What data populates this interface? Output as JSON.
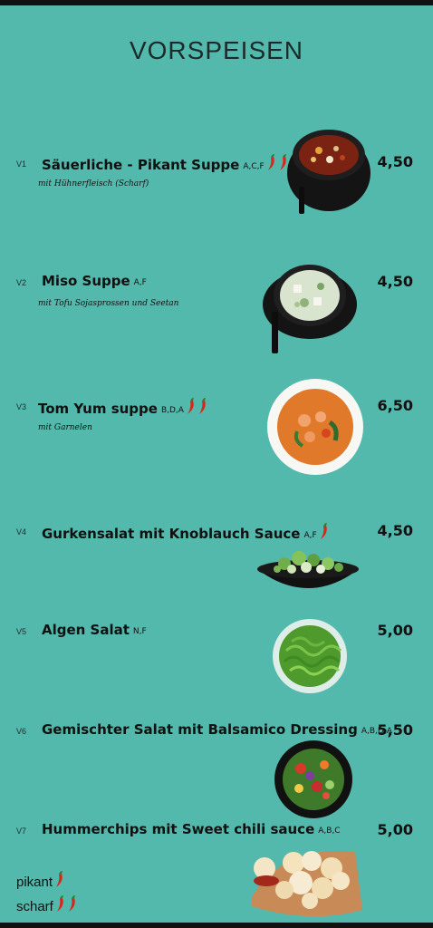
{
  "title": "VORSPEISEN",
  "items": [
    {
      "code": "V1",
      "name": "Säuerliche - Pikant Suppe",
      "allergens": "A,C,F",
      "chilis": 2,
      "desc": "mit Hühnerfleisch (Scharf)",
      "price": "4,50"
    },
    {
      "code": "V2",
      "name": "Miso Suppe",
      "allergens": "A,F",
      "chilis": 0,
      "desc": "mit Tofu Sojasprossen und Seetan",
      "price": "4,50"
    },
    {
      "code": "V3",
      "name": "Tom Yum suppe",
      "allergens": "B,D,A",
      "chilis": 2,
      "desc": "mit Garnelen",
      "price": "6,50"
    },
    {
      "code": "V4",
      "name": "Gurkensalat mit Knoblauch Sauce",
      "allergens": "A,F",
      "chilis": 1,
      "desc": "",
      "price": "4,50"
    },
    {
      "code": "V5",
      "name": "Algen Salat",
      "allergens": "N,F",
      "chilis": 0,
      "desc": "",
      "price": "5,00"
    },
    {
      "code": "V6",
      "name": "Gemischter Salat mit Balsamico Dressing",
      "allergens": "A,B,D,A",
      "chilis": 0,
      "desc": "",
      "price": "5,50"
    },
    {
      "code": "V7",
      "name": "Hummerchips mit Sweet chili sauce",
      "allergens": "A,B,C",
      "chilis": 0,
      "desc": "",
      "price": "5,00"
    }
  ],
  "legend": [
    {
      "label": "pikant",
      "chilis": 1,
      "icon": "chili-pepper-icon"
    },
    {
      "label": "scharf",
      "chilis": 2,
      "icon": "chili-pepper-icon"
    }
  ],
  "colors": {
    "background": "#53b9ac",
    "chili": "#d8261c"
  }
}
